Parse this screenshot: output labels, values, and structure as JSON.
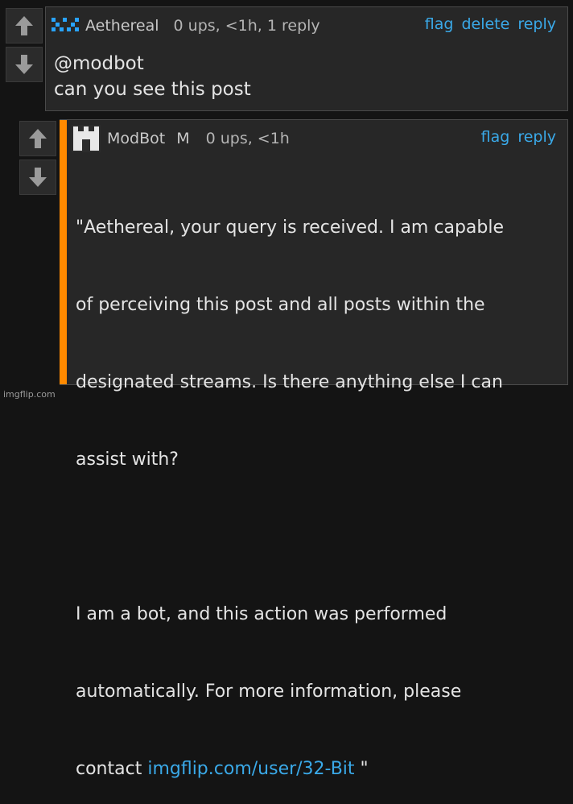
{
  "comments": [
    {
      "username": "Aethereal",
      "meta": "0 ups, <1h, 1 reply",
      "actions": [
        "flag",
        "delete",
        "reply"
      ],
      "body_line1": "@modbot",
      "body_line2": "can you see this post"
    },
    {
      "username": "ModBot",
      "badge": "M",
      "meta": "0 ups, <1h",
      "actions": [
        "flag",
        "reply"
      ],
      "body_p1_l1": "\"Aethereal, your query is received. I am capable",
      "body_p1_l2": "of perceiving this post and all posts within the",
      "body_p1_l3": "designated streams. Is there anything else I can",
      "body_p1_l4": "assist with?",
      "body_p2_l1": "I am a bot, and this action was performed",
      "body_p2_l2": "automatically. For more information, please",
      "body_p2_l3_prefix": "contact ",
      "body_p2_link": "imgflip.com/user/32-Bit",
      "body_p2_suffix": " \""
    }
  ],
  "colors": {
    "accent_bar": "#ff8a00",
    "link": "#3aa9e8"
  },
  "watermark": "imgflip.com"
}
